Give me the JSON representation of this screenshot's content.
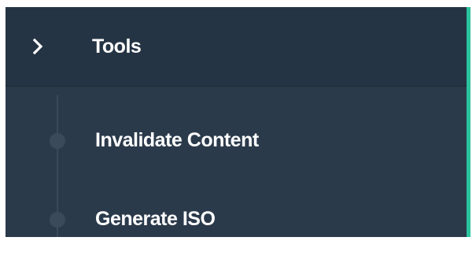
{
  "sidebar": {
    "accent_color": "#2bc49e",
    "background_color": "#2b3a4b",
    "section": {
      "label": "Tools",
      "icon": "chevron-right-icon",
      "expanded": true
    },
    "items": [
      {
        "label": "Invalidate Content"
      },
      {
        "label": "Generate ISO"
      }
    ]
  }
}
